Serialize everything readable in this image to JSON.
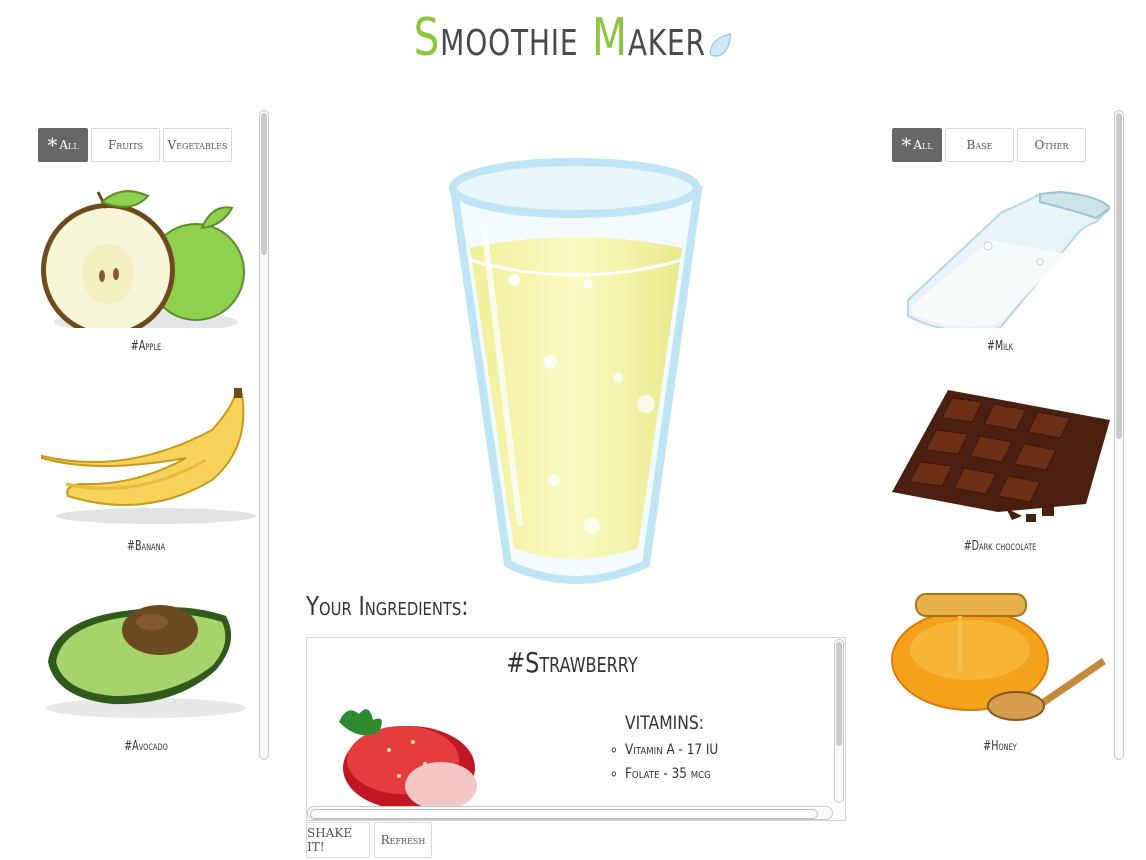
{
  "header": {
    "title_first_letter": "S",
    "title_rest1": "moothie ",
    "title_m": "M",
    "title_rest2": "aker"
  },
  "left_panel": {
    "filters": [
      {
        "label": "All",
        "active": true
      },
      {
        "label": "Fruits",
        "active": false
      },
      {
        "label": "Vegetables",
        "active": false
      }
    ],
    "items": [
      {
        "label": "#Apple",
        "icon": "apple-icon"
      },
      {
        "label": "#Banana",
        "icon": "banana-icon"
      },
      {
        "label": "#Avocado",
        "icon": "avocado-icon"
      }
    ]
  },
  "right_panel": {
    "filters": [
      {
        "label": "All",
        "active": true
      },
      {
        "label": "Base",
        "active": false
      },
      {
        "label": "Other",
        "active": false
      }
    ],
    "items": [
      {
        "label": "#Milk",
        "icon": "milk-bottle-icon"
      },
      {
        "label": "#Dark chocolate",
        "icon": "chocolate-icon"
      },
      {
        "label": "#Honey",
        "icon": "honey-pot-icon"
      }
    ]
  },
  "ingredients": {
    "heading": "Your Ingredients:",
    "current": {
      "name": "#Strawberry",
      "vitamins_title": "VITAMINS:",
      "vitamins": [
        "Vitamin A - 17 IU",
        "Folate - 35 mcg"
      ]
    }
  },
  "actions": {
    "shake_label": "SHAKE IT!",
    "refresh_label": "Refresh"
  },
  "colors": {
    "accent": "#8cc63f",
    "active_filter": "#666666",
    "juice": "#e8eb8f"
  }
}
